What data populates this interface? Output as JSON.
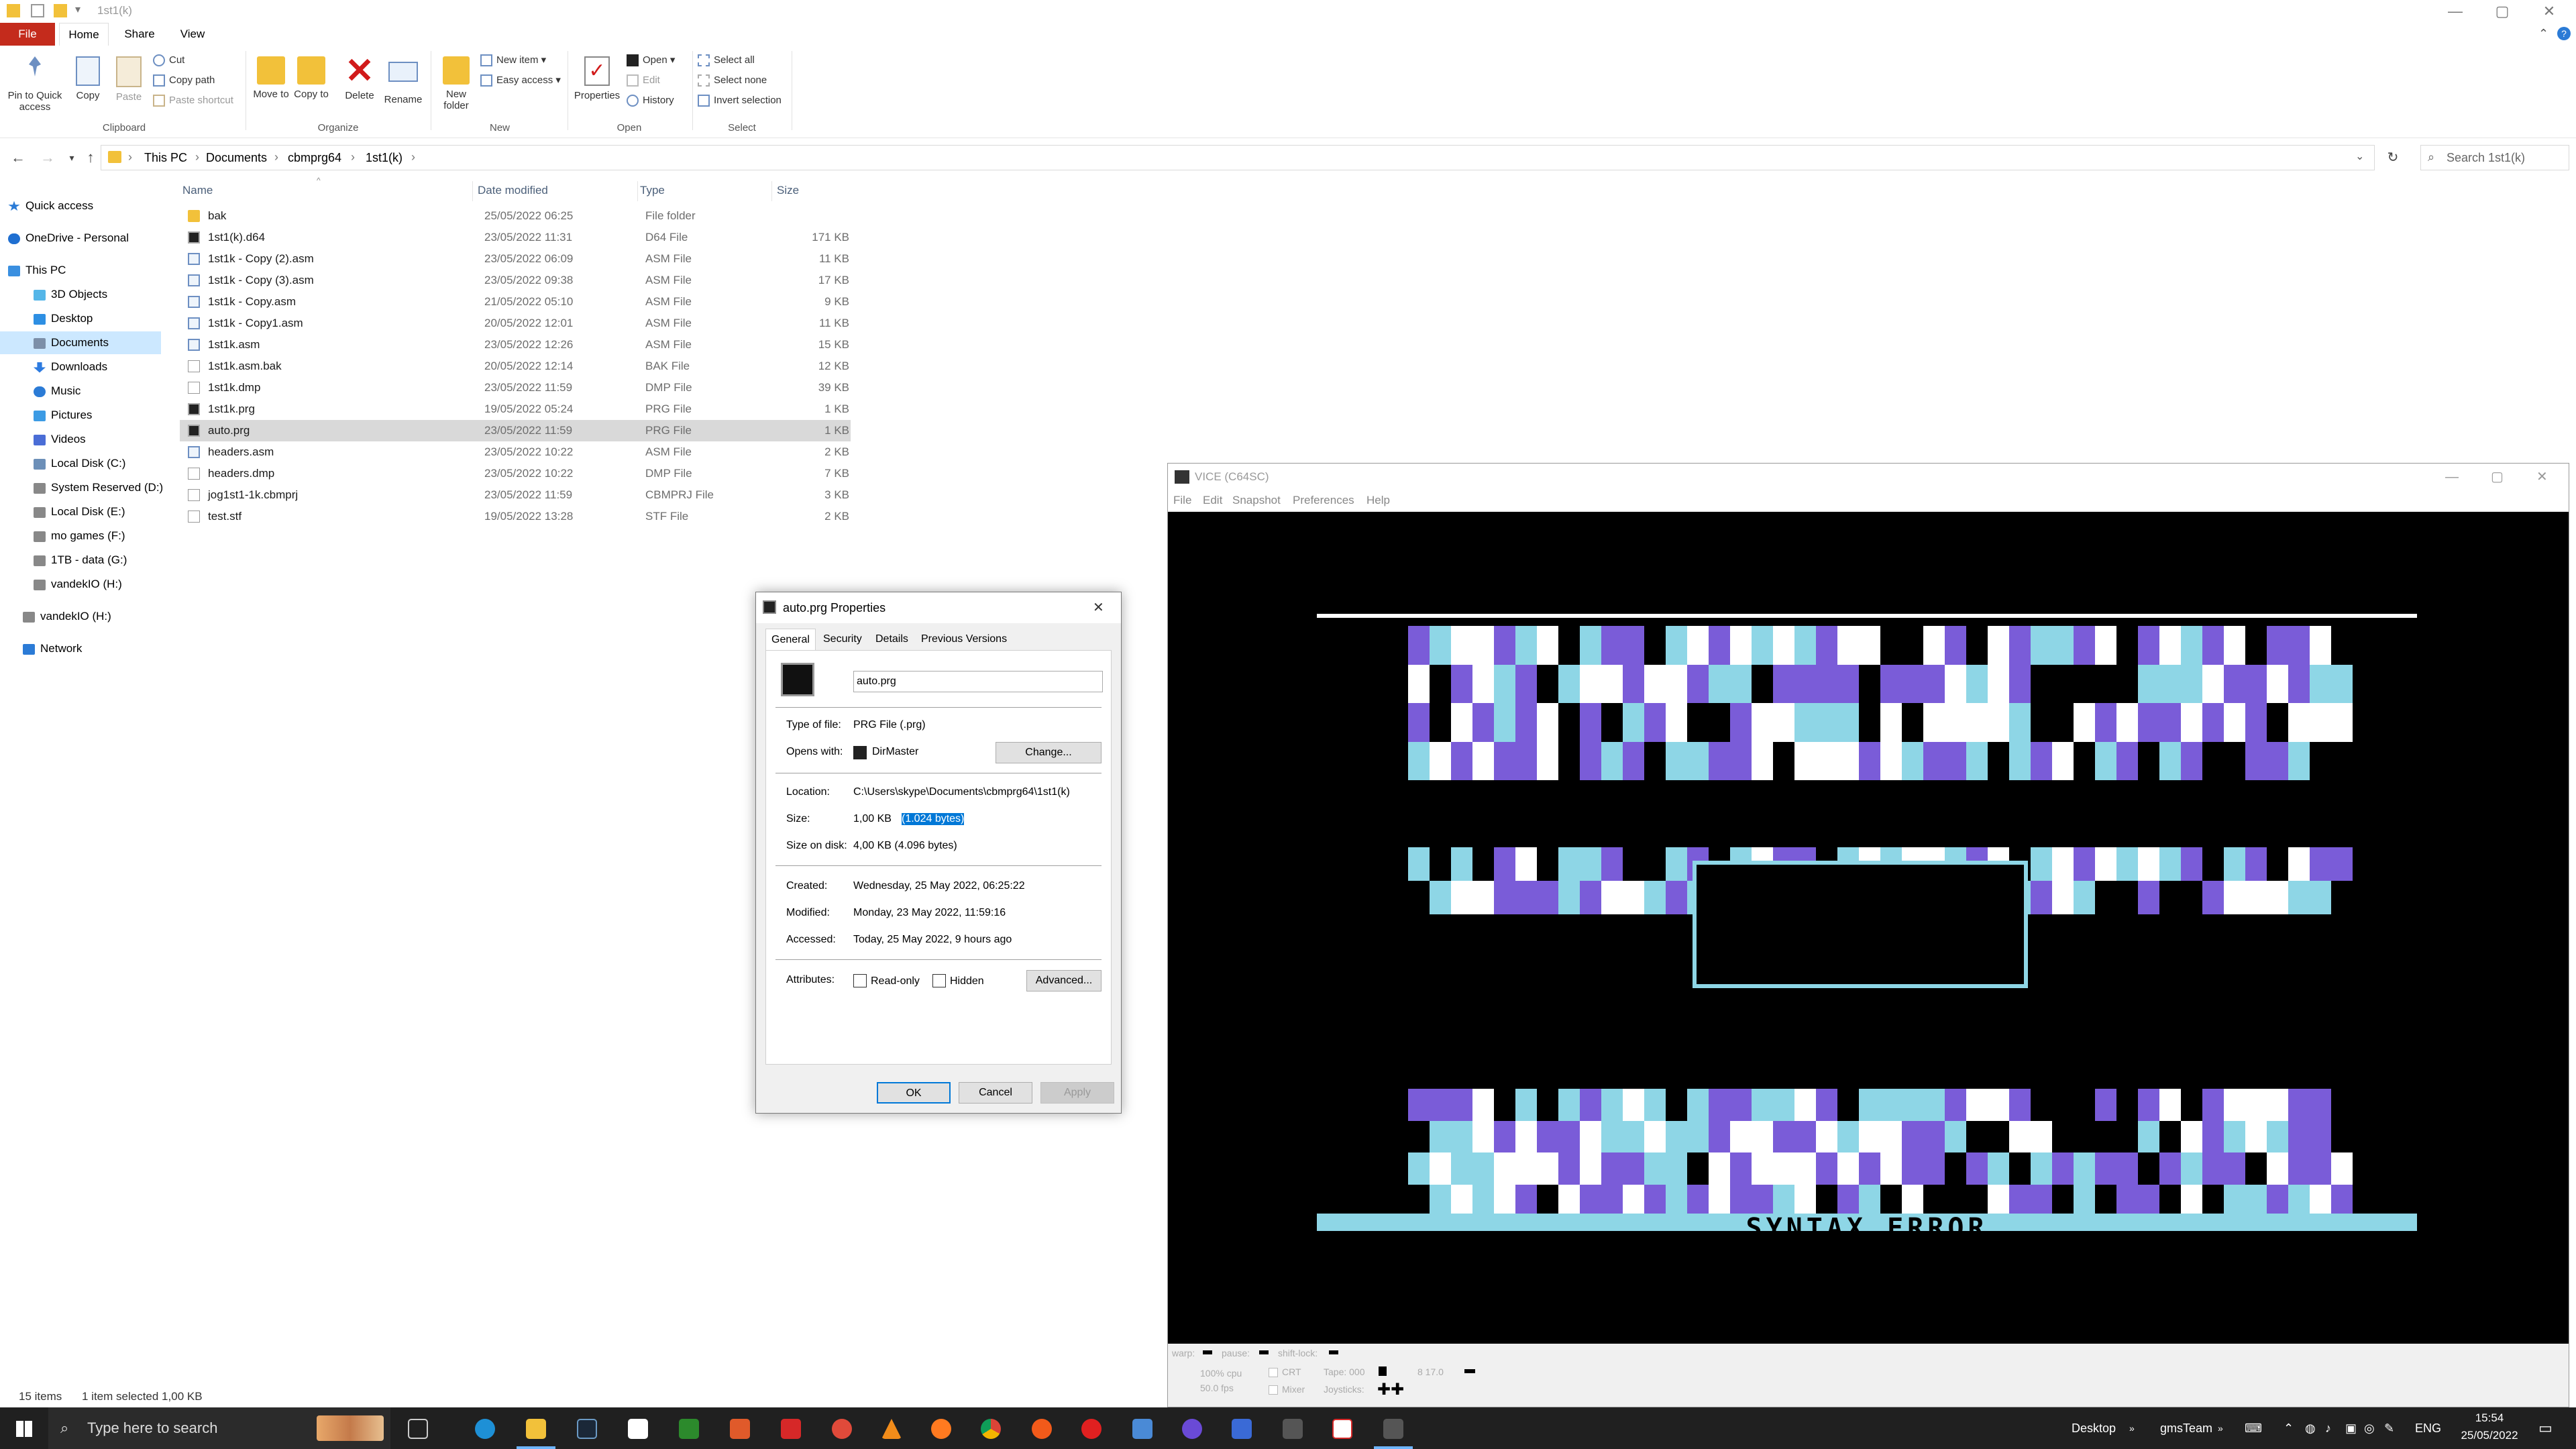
{
  "window_title": "1st1(k)",
  "ribbon_tabs": [
    "File",
    "Home",
    "Share",
    "View"
  ],
  "ribbon": {
    "pin_label": "Pin to Quick access",
    "copy_label": "Copy",
    "paste_label": "Paste",
    "cut_label": "Cut",
    "copy_path_label": "Copy path",
    "paste_shortcut_label": "Paste shortcut",
    "move_to_label": "Move to",
    "copy_to_label": "Copy to",
    "delete_label": "Delete",
    "rename_label": "Rename",
    "new_folder_label": "New folder",
    "new_item_label": "New item",
    "easy_access_label": "Easy access",
    "properties_label": "Properties",
    "open_label": "Open",
    "edit_label": "Edit",
    "history_label": "History",
    "select_all_label": "Select all",
    "select_none_label": "Select none",
    "invert_selection_label": "Invert selection",
    "groups": [
      "Clipboard",
      "Organize",
      "New",
      "Open",
      "Select"
    ]
  },
  "breadcrumb": [
    "This PC",
    "Documents",
    "cbmprg64",
    "1st1(k)"
  ],
  "search_placeholder": "Search 1st1(k)",
  "nav": [
    {
      "label": "Quick access",
      "color": "#2b7bd6"
    },
    {
      "label": "OneDrive - Personal",
      "color": "#1f6fd1"
    },
    {
      "label": "This PC",
      "color": "#3a8fe0"
    },
    {
      "label": "3D Objects",
      "color": "#54b6e8"
    },
    {
      "label": "Desktop",
      "color": "#2d8fe3"
    },
    {
      "label": "Documents",
      "color": "#7c8fa8"
    },
    {
      "label": "Downloads",
      "color": "#2d7be0"
    },
    {
      "label": "Music",
      "color": "#2b7bd6"
    },
    {
      "label": "Pictures",
      "color": "#3c9be4"
    },
    {
      "label": "Videos",
      "color": "#4a6dd6"
    },
    {
      "label": "Local Disk (C:)",
      "color": "#6c8fb8"
    },
    {
      "label": "System Reserved (D:)",
      "color": "#888888"
    },
    {
      "label": "Local Disk (E:)",
      "color": "#888888"
    },
    {
      "label": "mo games (F:)",
      "color": "#888888"
    },
    {
      "label": "1TB - data (G:)",
      "color": "#888888"
    },
    {
      "label": "vandekIO (H:)",
      "color": "#888888"
    },
    {
      "label": "vandekIO (H:)",
      "color": "#888888"
    },
    {
      "label": "Network",
      "color": "#2b7bd6"
    }
  ],
  "columns": [
    "Name",
    "Date modified",
    "Type",
    "Size"
  ],
  "files": [
    {
      "name": "bak",
      "date": "25/05/2022 06:25",
      "type": "File folder",
      "size": "",
      "icon": "folder"
    },
    {
      "name": "1st1(k).d64",
      "date": "23/05/2022 11:31",
      "type": "D64 File",
      "size": "171 KB",
      "icon": "disk"
    },
    {
      "name": "1st1k - Copy (2).asm",
      "date": "23/05/2022 06:09",
      "type": "ASM File",
      "size": "11 KB",
      "icon": "asm"
    },
    {
      "name": "1st1k - Copy (3).asm",
      "date": "23/05/2022 09:38",
      "type": "ASM File",
      "size": "17 KB",
      "icon": "asm"
    },
    {
      "name": "1st1k - Copy.asm",
      "date": "21/05/2022 05:10",
      "type": "ASM File",
      "size": "9 KB",
      "icon": "asm"
    },
    {
      "name": "1st1k - Copy1.asm",
      "date": "20/05/2022 12:01",
      "type": "ASM File",
      "size": "11 KB",
      "icon": "asm"
    },
    {
      "name": "1st1k.asm",
      "date": "23/05/2022 12:26",
      "type": "ASM File",
      "size": "15 KB",
      "icon": "asm"
    },
    {
      "name": "1st1k.asm.bak",
      "date": "20/05/2022 12:14",
      "type": "BAK File",
      "size": "12 KB",
      "icon": "blank"
    },
    {
      "name": "1st1k.dmp",
      "date": "23/05/2022 11:59",
      "type": "DMP File",
      "size": "39 KB",
      "icon": "blank"
    },
    {
      "name": "1st1k.prg",
      "date": "19/05/2022 05:24",
      "type": "PRG File",
      "size": "1 KB",
      "icon": "disk"
    },
    {
      "name": "auto.prg",
      "date": "23/05/2022 11:59",
      "type": "PRG File",
      "size": "1 KB",
      "icon": "disk",
      "selected": true
    },
    {
      "name": "headers.asm",
      "date": "23/05/2022 10:22",
      "type": "ASM File",
      "size": "2 KB",
      "icon": "asm"
    },
    {
      "name": "headers.dmp",
      "date": "23/05/2022 10:22",
      "type": "DMP File",
      "size": "7 KB",
      "icon": "blank"
    },
    {
      "name": "jog1st1-1k.cbmprj",
      "date": "23/05/2022 11:59",
      "type": "CBMPRJ File",
      "size": "3 KB",
      "icon": "blank"
    },
    {
      "name": "test.stf",
      "date": "19/05/2022 13:28",
      "type": "STF File",
      "size": "2 KB",
      "icon": "blank"
    }
  ],
  "status": {
    "count": "15 items",
    "selection": "1 item selected  1,00 KB"
  },
  "dialog": {
    "title": "auto.prg Properties",
    "tabs": [
      "General",
      "Security",
      "Details",
      "Previous Versions"
    ],
    "filename": "auto.prg",
    "type_label": "Type of file:",
    "type_value": "PRG File (.prg)",
    "opens_label": "Opens with:",
    "opens_value": "DirMaster",
    "change_label": "Change...",
    "location_label": "Location:",
    "location_value": "C:\\Users\\skype\\Documents\\cbmprg64\\1st1(k)",
    "size_label": "Size:",
    "size_value": "1,00 KB",
    "size_bytes": "(1.024 bytes)",
    "disk_label": "Size on disk:",
    "disk_value": "4,00 KB (4.096 bytes)",
    "created_label": "Created:",
    "created_value": "Wednesday, 25 May 2022, 06:25:22",
    "modified_label": "Modified:",
    "modified_value": "Monday, 23 May 2022, 11:59:16",
    "accessed_label": "Accessed:",
    "accessed_value": "Today, 25 May 2022, 9 hours ago",
    "attributes_label": "Attributes:",
    "readonly_label": "Read-only",
    "hidden_label": "Hidden",
    "advanced_label": "Advanced...",
    "ok_label": "OK",
    "cancel_label": "Cancel",
    "apply_label": "Apply"
  },
  "vice": {
    "title": "VICE (C64SC)",
    "menu": [
      "File",
      "Edit",
      "Snapshot",
      "Preferences",
      "Help"
    ],
    "screen_text": "SYNTAX ERROR",
    "status": {
      "warp": "warp:",
      "pause": "pause:",
      "shift_lock": "shift-lock:",
      "cpu": "100% cpu",
      "fps": "50.0 fps",
      "crt": "CRT",
      "mixer": "Mixer",
      "tape": "Tape: 000",
      "joysticks": "Joysticks:",
      "drive": "8  17.0"
    },
    "colors": {
      "white": "#ffffff",
      "purple": "#7a5cd8",
      "cyan": "#8ed6e6",
      "black": "#000000"
    }
  },
  "taskbar": {
    "search_placeholder": "Type here to search",
    "desktop_label": "Desktop",
    "team_label": "gmsTeam",
    "lang": "ENG",
    "time": "15:54",
    "date": "25/05/2022"
  },
  "accent": "#c42b1c"
}
